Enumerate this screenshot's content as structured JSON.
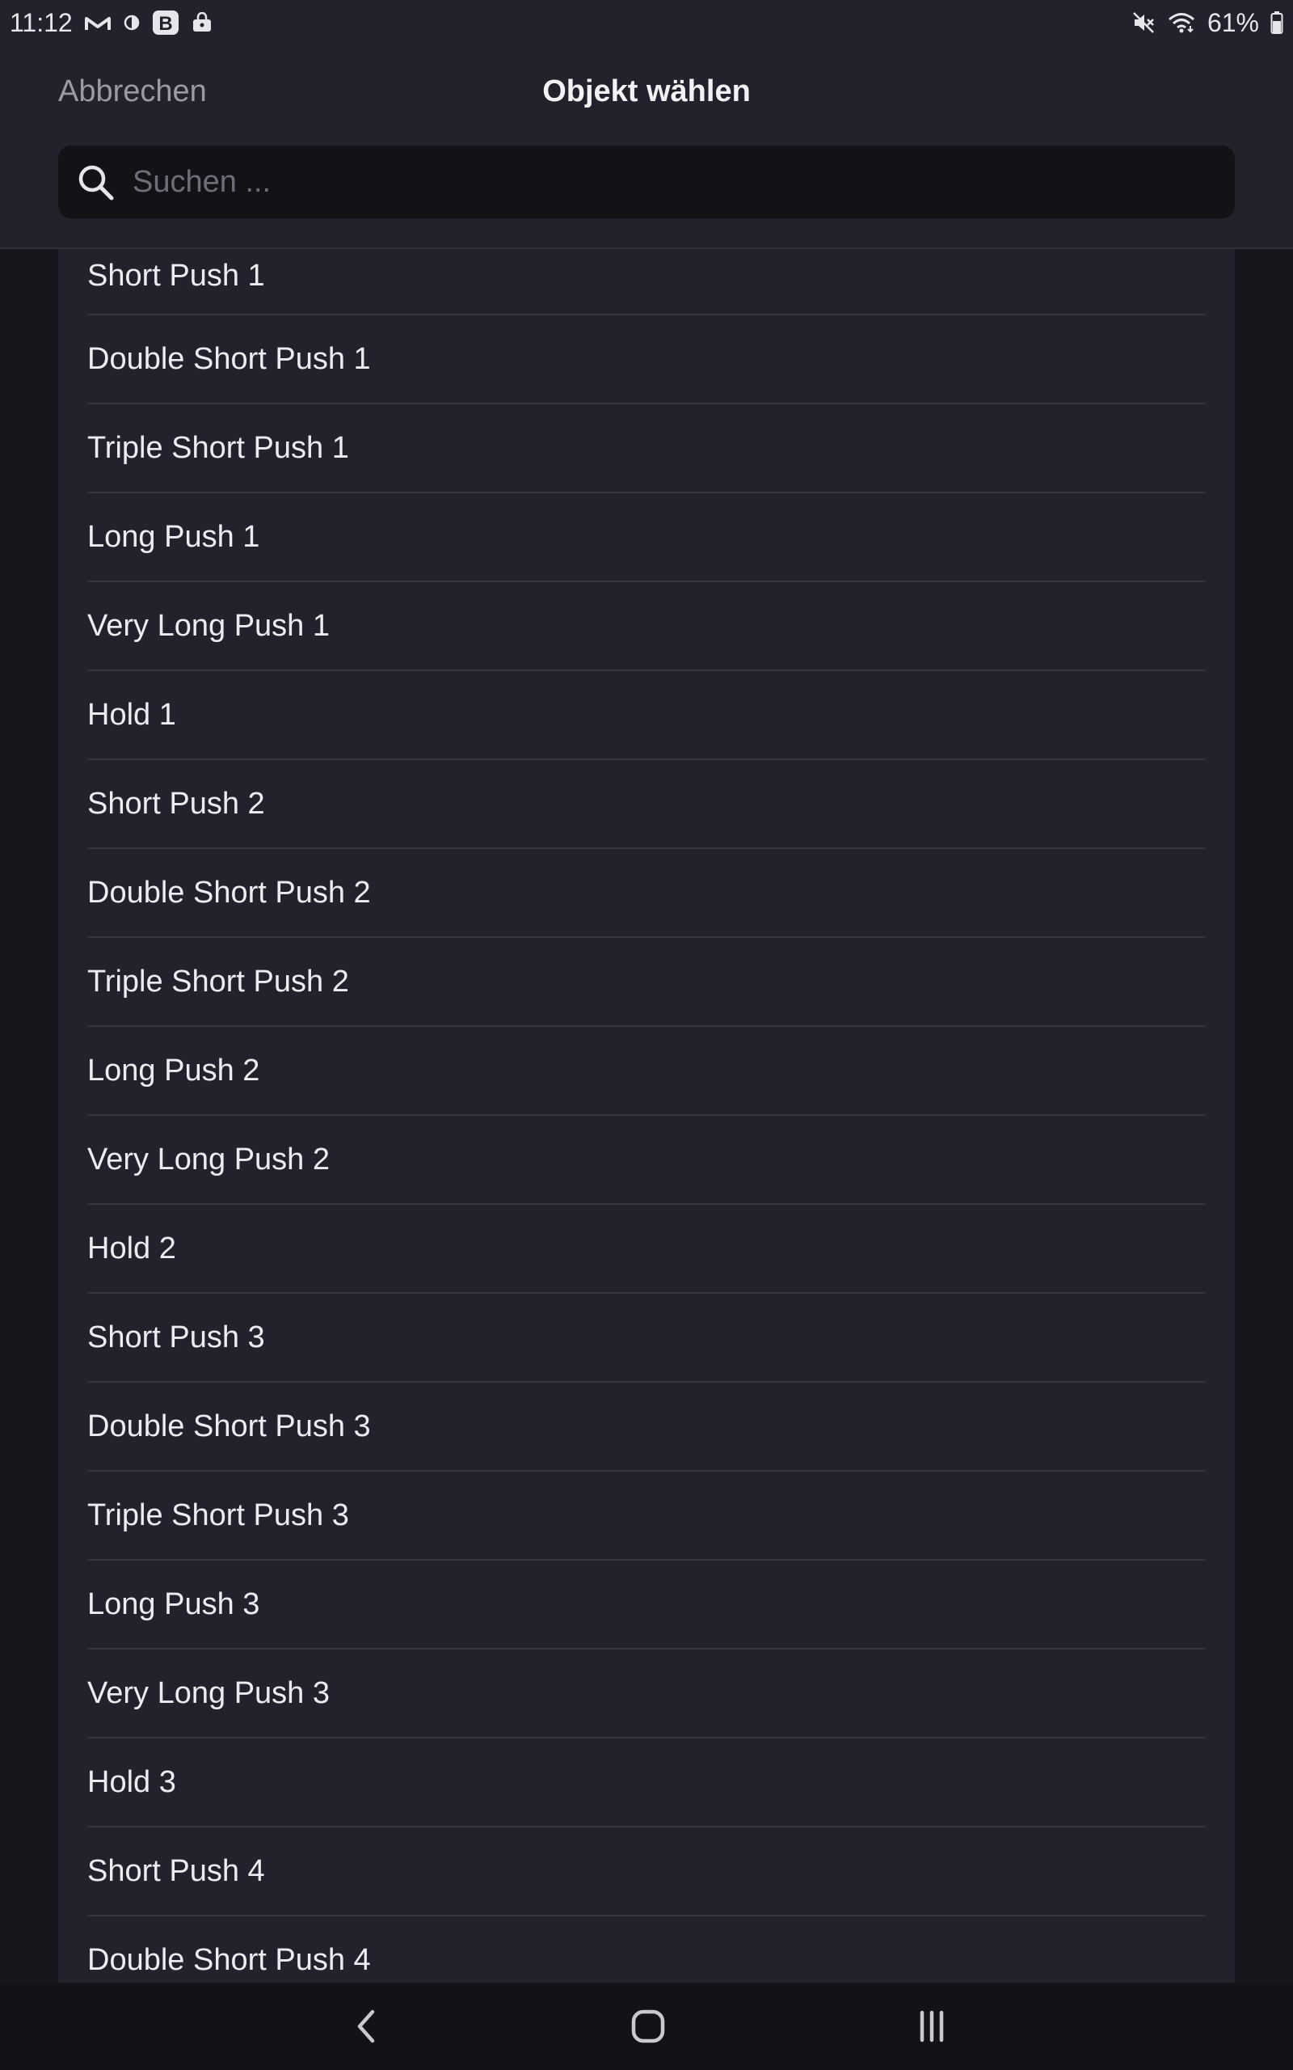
{
  "status_bar": {
    "time": "11:12",
    "battery": "61%",
    "left_icons": [
      "gmail-m-icon",
      "contrast-icon",
      "b-app-icon",
      "lock-bag-icon"
    ],
    "right_icons": [
      "mute-icon",
      "wifi-icon",
      "battery-icon"
    ]
  },
  "header": {
    "cancel_label": "Abbrechen",
    "title": "Objekt wählen"
  },
  "search": {
    "placeholder": "Suchen ...",
    "value": ""
  },
  "list": {
    "items": [
      "Short Push 1",
      "Double Short Push 1",
      "Triple Short Push 1",
      "Long Push 1",
      "Very Long Push 1",
      "Hold 1",
      "Short Push 2",
      "Double Short Push 2",
      "Triple Short Push 2",
      "Long Push 2",
      "Very Long Push 2",
      "Hold 2",
      "Short Push 3",
      "Double Short Push 3",
      "Triple Short Push 3",
      "Long Push 3",
      "Very Long Push 3",
      "Hold 3",
      "Short Push 4",
      "Double Short Push 4"
    ]
  },
  "nav_bar": {
    "buttons": [
      "back-icon",
      "home-icon",
      "recents-icon"
    ]
  },
  "colors": {
    "background": "#16161c",
    "panel": "#22222c",
    "search_field": "#121217",
    "divider": "#34343f",
    "text": "#ececf0",
    "muted_text": "#9a9aa3"
  }
}
